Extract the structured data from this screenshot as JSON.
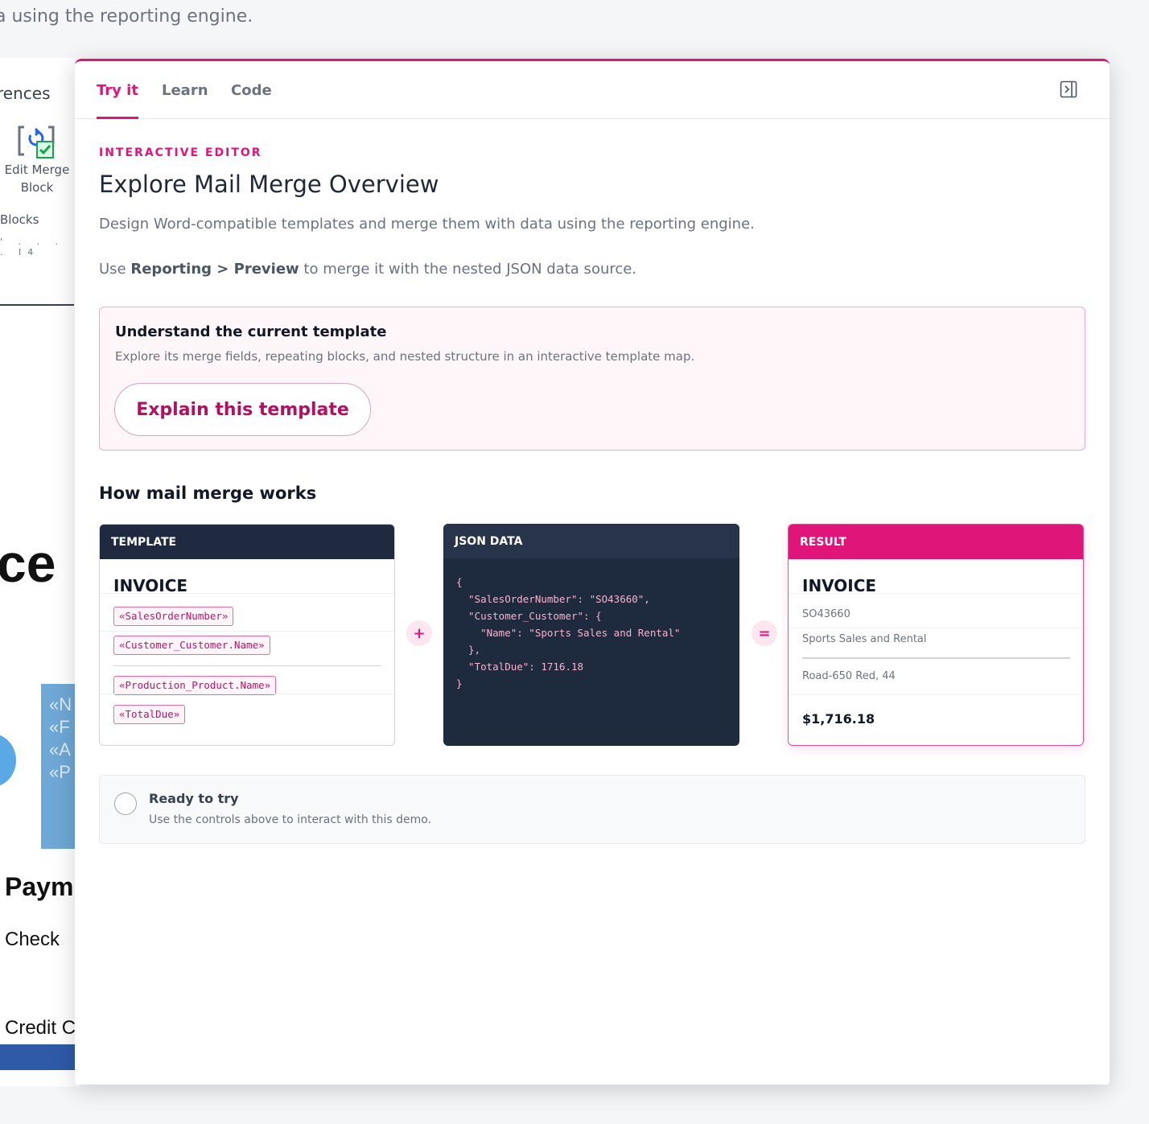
{
  "background": {
    "subtitle": "a using the reporting engine.",
    "ribbon_label": "rences",
    "edit_merge_block": "Edit Merge Block",
    "blocks": "Blocks",
    "ruler": "' . . . . I4",
    "big_text": "ce",
    "table_rows": [
      "«N",
      "«F",
      "«A",
      "«P"
    ],
    "paym": "Paym",
    "check": "Check",
    "credit": "Credit C"
  },
  "tabs": [
    {
      "label": "Try it",
      "active": true
    },
    {
      "label": "Learn",
      "active": false
    },
    {
      "label": "Code",
      "active": false
    }
  ],
  "collapse_icon": "sidebar-collapse-icon",
  "eyebrow": "INTERACTIVE EDITOR",
  "title": "Explore Mail Merge Overview",
  "description": "Design Word-compatible templates and merge them with data using the reporting engine.",
  "instruction": {
    "prefix": "Use ",
    "bold1": "Reporting",
    "sep": " > ",
    "bold2": "Preview",
    "suffix": " to merge it with the nested JSON data source."
  },
  "callout": {
    "title": "Understand the current template",
    "description": "Explore its merge fields, repeating blocks, and nested structure in an interactive template map.",
    "button": "Explain this template"
  },
  "section_title": "How mail merge works",
  "template_card": {
    "header": "TEMPLATE",
    "title": "INVOICE",
    "fields": [
      "«SalesOrderNumber»",
      "«Customer_Customer.Name»",
      "«Production_Product.Name»",
      "«TotalDue»"
    ]
  },
  "plus_symbol": "+",
  "json_card": {
    "header": "JSON DATA",
    "code": "{\n  \"SalesOrderNumber\": \"SO43660\",\n  \"Customer_Customer\": {\n    \"Name\": \"Sports Sales and Rental\"\n  },\n  \"TotalDue\": 1716.18\n}"
  },
  "equals_symbol": "=",
  "result_card": {
    "header": "RESULT",
    "title": "INVOICE",
    "order_number": "SO43660",
    "customer": "Sports Sales and Rental",
    "product": "Road-650 Red, 44",
    "total": "$1,716.18"
  },
  "status": {
    "title": "Ready to try",
    "description": "Use the controls above to interact with this demo."
  },
  "colors": {
    "accent": "#e0157a",
    "dark_header": "#1f2a40",
    "json_bg": "#1e2a3d"
  }
}
